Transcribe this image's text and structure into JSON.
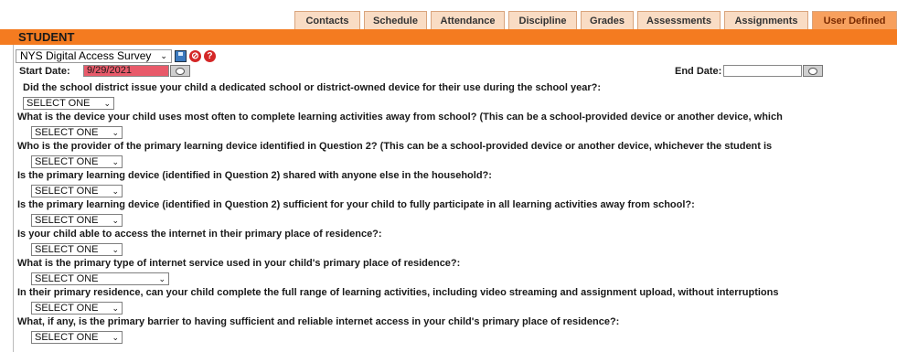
{
  "tabs": [
    {
      "label": "Contacts",
      "active": false
    },
    {
      "label": "Schedule",
      "active": false
    },
    {
      "label": "Attendance",
      "active": false
    },
    {
      "label": "Discipline",
      "active": false
    },
    {
      "label": "Grades",
      "active": false
    },
    {
      "label": "Assessments",
      "active": false
    },
    {
      "label": "Assignments",
      "active": false
    },
    {
      "label": "User Defined",
      "active": true
    }
  ],
  "header": {
    "title": "STUDENT"
  },
  "survey": {
    "selected": "NYS Digital Access Survey",
    "icons": [
      "save-icon",
      "delete-icon",
      "help-icon"
    ]
  },
  "dates": {
    "start_label": "Start Date:",
    "start_value": "9/29/2021",
    "end_label": "End Date:",
    "end_value": ""
  },
  "questions": [
    {
      "text": "Did the school district issue your child a dedicated school or district-owned device for their use during the school year?:",
      "answer": "SELECT ONE"
    },
    {
      "text": "What is the device your child uses most often to complete learning activities away from school? (This can be a school-provided device or another device, which",
      "answer": "SELECT ONE"
    },
    {
      "text": "Who is the provider of the primary learning device identified in Question 2? (This can be a school-provided device or another device, whichever the student is",
      "answer": "SELECT ONE"
    },
    {
      "text": "Is the primary learning device (identified in Question 2) shared with anyone else in the household?:",
      "answer": "SELECT ONE"
    },
    {
      "text": "Is the primary learning device (identified in Question 2) sufficient for your child to fully participate in all learning activities away from school?:",
      "answer": "SELECT ONE"
    },
    {
      "text": "Is your child able to access the internet in their primary place of residence?:",
      "answer": "SELECT ONE"
    },
    {
      "text": "What is the primary type of internet service used in your child's primary place of residence?:",
      "answer": "SELECT ONE"
    },
    {
      "text": "In their primary residence, can your child complete the full range of learning activities, including video streaming and assignment upload, without interruptions",
      "answer": "SELECT ONE"
    },
    {
      "text": "What, if any, is the primary barrier to having sufficient and reliable internet access in your child's primary place of residence?:",
      "answer": "SELECT ONE"
    }
  ],
  "colors": {
    "header": "#f47b20",
    "tab": "#f9dcc4",
    "tab_active": "#f7a05e",
    "start_date_bg": "#e85a6a"
  }
}
